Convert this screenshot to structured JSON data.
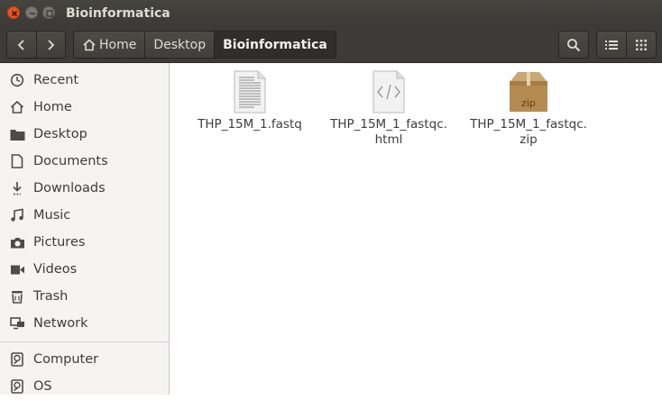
{
  "window": {
    "title": "Bioinformatica"
  },
  "toolbar": {
    "breadcrumbs": [
      "Home",
      "Desktop",
      "Bioinformatica"
    ]
  },
  "sidebar": {
    "items": [
      {
        "label": "Recent",
        "icon": "clock-icon"
      },
      {
        "label": "Home",
        "icon": "home-icon"
      },
      {
        "label": "Desktop",
        "icon": "folder-icon"
      },
      {
        "label": "Documents",
        "icon": "document-icon"
      },
      {
        "label": "Downloads",
        "icon": "download-icon"
      },
      {
        "label": "Music",
        "icon": "music-icon"
      },
      {
        "label": "Pictures",
        "icon": "camera-icon"
      },
      {
        "label": "Videos",
        "icon": "video-icon"
      },
      {
        "label": "Trash",
        "icon": "trash-icon"
      },
      {
        "label": "Network",
        "icon": "network-icon"
      },
      {
        "label": "Computer",
        "icon": "drive-icon"
      },
      {
        "label": "OS",
        "icon": "drive-icon"
      }
    ]
  },
  "files": [
    {
      "name_line1": "THP_15M_1.fastq",
      "name_line2": "",
      "icon": "text-file-icon"
    },
    {
      "name_line1": "THP_15M_1_fastqc.",
      "name_line2": "html",
      "icon": "html-file-icon"
    },
    {
      "name_line1": "THP_15M_1_fastqc.",
      "name_line2": "zip",
      "icon": "zip-archive-icon",
      "icon_text": "zip"
    }
  ]
}
